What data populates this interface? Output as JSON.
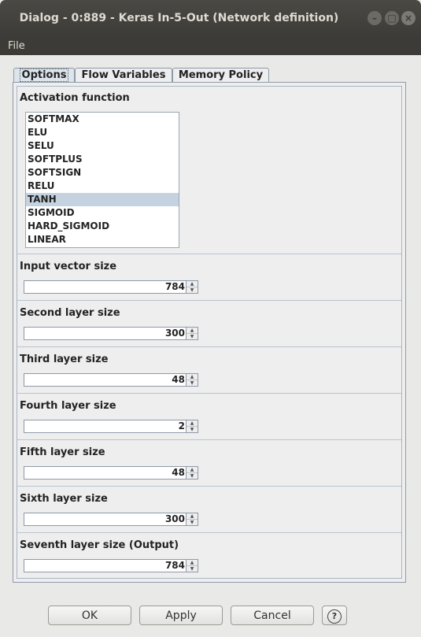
{
  "window": {
    "title": "Dialog - 0:889 - Keras In-5-Out (Network definition)",
    "controls": {
      "minimize": "–",
      "maximize": "□",
      "close": "×"
    }
  },
  "menu": {
    "file": "File"
  },
  "tabs": [
    {
      "label": "Options",
      "active": true
    },
    {
      "label": "Flow Variables",
      "active": false
    },
    {
      "label": "Memory Policy",
      "active": false
    }
  ],
  "activation": {
    "title": "Activation function",
    "items": [
      "SOFTMAX",
      "ELU",
      "SELU",
      "SOFTPLUS",
      "SOFTSIGN",
      "RELU",
      "TANH",
      "SIGMOID",
      "HARD_SIGMOID",
      "LINEAR"
    ],
    "selected": "TANH"
  },
  "layers": [
    {
      "label": "Input vector size",
      "value": "784"
    },
    {
      "label": "Second layer size",
      "value": "300"
    },
    {
      "label": "Third layer size",
      "value": "48"
    },
    {
      "label": "Fourth layer size",
      "value": "2"
    },
    {
      "label": "Fifth layer size",
      "value": "48"
    },
    {
      "label": "Sixth layer size",
      "value": "300"
    },
    {
      "label": "Seventh layer size (Output)",
      "value": "784"
    }
  ],
  "buttons": {
    "ok": "OK",
    "apply": "Apply",
    "cancel": "Cancel",
    "help": "?"
  },
  "icons": {
    "spin_up": "▲",
    "spin_down": "▼"
  }
}
